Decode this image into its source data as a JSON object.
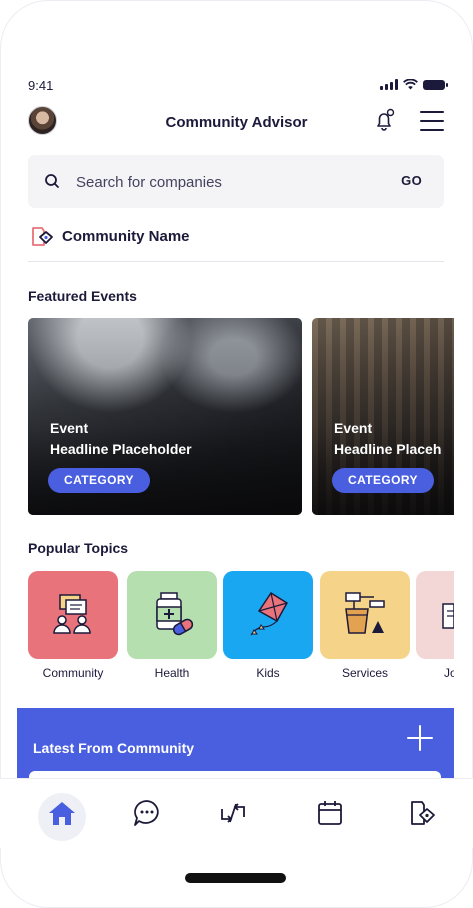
{
  "status_bar": {
    "time": "9:41"
  },
  "header": {
    "title": "Community Advisor"
  },
  "search": {
    "placeholder": "Search for companies",
    "go_label": "GO"
  },
  "community": {
    "name": "Community Name"
  },
  "featured": {
    "title": "Featured Events",
    "cards": [
      {
        "event": "Event",
        "headline": "Headline Placeholder",
        "category": "CATEGORY"
      },
      {
        "event": "Event",
        "headline": "Headline Placeh",
        "category": "CATEGORY"
      }
    ]
  },
  "topics": {
    "title": "Popular Topics",
    "items": [
      {
        "label": "Community",
        "color": "#e8737a"
      },
      {
        "label": "Health",
        "color": "#b6dfb0"
      },
      {
        "label": "Kids",
        "color": "#19a7f1"
      },
      {
        "label": "Services",
        "color": "#f5d48a"
      },
      {
        "label": "Jo",
        "color": "#f3d6d6"
      }
    ]
  },
  "latest": {
    "title": "Latest From Community"
  },
  "colors": {
    "accent": "#4a5fe0",
    "text": "#1c1a3a"
  },
  "bottom_nav": {
    "items": [
      "home-icon",
      "chat-icon",
      "exchange-icon",
      "calendar-icon",
      "community-icon"
    ]
  }
}
